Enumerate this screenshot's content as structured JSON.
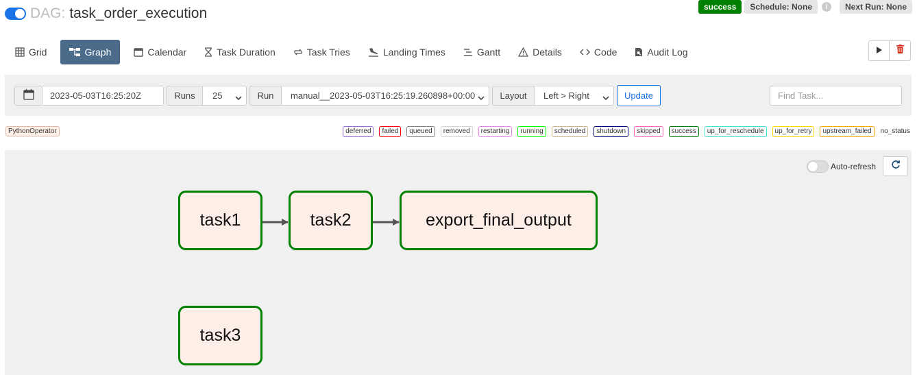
{
  "header": {
    "dag_prefix": "DAG:",
    "dag_id": "task_order_execution",
    "status": "success",
    "schedule": "Schedule: None",
    "next_run": "Next Run: None",
    "info_glyph": "i"
  },
  "nav": {
    "tabs": [
      {
        "label": "Grid",
        "icon": "grid-icon"
      },
      {
        "label": "Graph",
        "icon": "graph-icon",
        "active": true
      },
      {
        "label": "Calendar",
        "icon": "calendar-icon"
      },
      {
        "label": "Task Duration",
        "icon": "hourglass-icon"
      },
      {
        "label": "Task Tries",
        "icon": "retry-icon"
      },
      {
        "label": "Landing Times",
        "icon": "plane-landing-icon"
      },
      {
        "label": "Gantt",
        "icon": "gantt-icon"
      },
      {
        "label": "Details",
        "icon": "warning-triangle-icon"
      },
      {
        "label": "Code",
        "icon": "code-icon"
      },
      {
        "label": "Audit Log",
        "icon": "file-search-icon"
      }
    ]
  },
  "toolbar": {
    "base_date": "2023-05-03T16:25:20Z",
    "runs_label": "Runs",
    "runs_value": "25",
    "run_label": "Run",
    "run_value": "manual__2023-05-03T16:25:19.260898+00:00",
    "layout_label": "Layout",
    "layout_value": "Left > Right",
    "update_label": "Update",
    "find_placeholder": "Find Task..."
  },
  "legend": {
    "operator": "PythonOperator",
    "operator_color": "#fff0e8",
    "states": [
      {
        "label": "deferred",
        "color": "#9370db"
      },
      {
        "label": "failed",
        "color": "#ff0000"
      },
      {
        "label": "queued",
        "color": "#808080"
      },
      {
        "label": "removed",
        "color": "#d3d3d3"
      },
      {
        "label": "restarting",
        "color": "#ee82ee"
      },
      {
        "label": "running",
        "color": "#00ff00"
      },
      {
        "label": "scheduled",
        "color": "#d2b48c"
      },
      {
        "label": "shutdown",
        "color": "#000080"
      },
      {
        "label": "skipped",
        "color": "#ff69b4"
      },
      {
        "label": "success",
        "color": "#008000"
      },
      {
        "label": "up_for_reschedule",
        "color": "#40e0d0"
      },
      {
        "label": "up_for_retry",
        "color": "#ffd700"
      },
      {
        "label": "upstream_failed",
        "color": "#ffa500"
      },
      {
        "label": "no_status",
        "color": ""
      }
    ]
  },
  "graph": {
    "auto_refresh_label": "Auto-refresh",
    "auto_refresh_on": false,
    "nodes": [
      {
        "id": "task1",
        "label": "task1",
        "state": "success"
      },
      {
        "id": "task2",
        "label": "task2",
        "state": "success"
      },
      {
        "id": "export_final_output",
        "label": "export_final_output",
        "state": "success"
      },
      {
        "id": "task3",
        "label": "task3",
        "state": "success"
      }
    ],
    "edges": [
      {
        "from": "task1",
        "to": "task2"
      },
      {
        "from": "task2",
        "to": "export_final_output"
      }
    ]
  }
}
